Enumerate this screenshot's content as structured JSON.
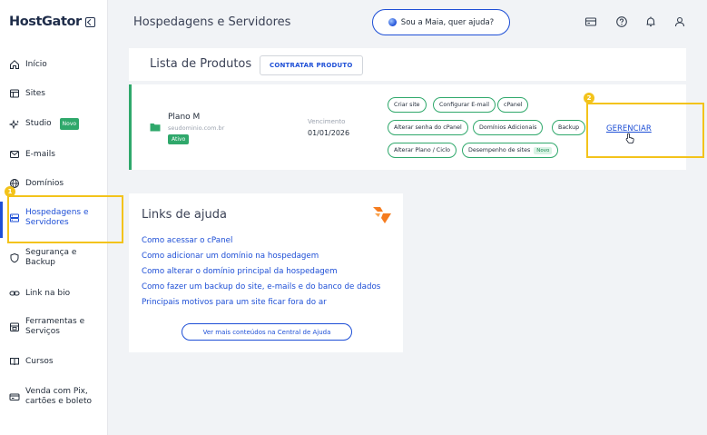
{
  "sidebar": {
    "logo": "HostGator",
    "items": [
      {
        "label": "Início",
        "icon": "home-icon"
      },
      {
        "label": "Sites",
        "icon": "browser-icon"
      },
      {
        "label": "Studio",
        "icon": "sparkles-icon",
        "badge": "Novo"
      },
      {
        "label": "E-mails",
        "icon": "mail-icon"
      },
      {
        "label": "Domínios",
        "icon": "globe-icon"
      },
      {
        "label": "Hospedagens e Servidores",
        "icon": "server-icon"
      },
      {
        "label": "Segurança e Backup",
        "icon": "shield-icon"
      },
      {
        "label": "Link na bio",
        "icon": "link-icon"
      },
      {
        "label": "Ferramentas e Serviços",
        "icon": "tools-icon"
      },
      {
        "label": "Cursos",
        "icon": "book-icon"
      },
      {
        "label": "Venda com Pix, cartões e boleto",
        "icon": "payment-icon"
      }
    ]
  },
  "header": {
    "title": "Hospedagens e Servidores",
    "help_label": "Sou a Maia, quer ajuda?"
  },
  "products": {
    "title": "Lista de Produtos",
    "contract_label": "CONTRATAR PRODUTO",
    "plan": {
      "name": "Plano M",
      "domain": "seudominio.com.br",
      "status": "Ativo",
      "due_label": "Vencimento",
      "due_date": "01/01/2026",
      "actions": [
        "Criar site",
        "Configurar E-mail",
        "cPanel",
        "Alterar senha do cPanel",
        "Domínios Adicionais",
        "Backup",
        "Alterar Plano / Ciclo",
        "Desempenho de sites"
      ],
      "new_badge": "Novo",
      "manage_label": "GERENCIAR"
    }
  },
  "help": {
    "title": "Links de ajuda",
    "links": [
      "Como acessar o cPanel",
      "Como adicionar um domínio na hospedagem",
      "Como alterar o domínio principal da hospedagem",
      "Como fazer um backup do site, e-mails e do banco de dados",
      "Principais motivos para um site ficar fora do ar"
    ],
    "more_label": "Ver mais conteúdos na Central de Ajuda"
  },
  "markers": [
    "1",
    "2"
  ],
  "colors": {
    "accent": "#1e4fd6",
    "success": "#2fa86b",
    "highlight": "#f3c31b",
    "brand_orange": "#f57c1f"
  }
}
